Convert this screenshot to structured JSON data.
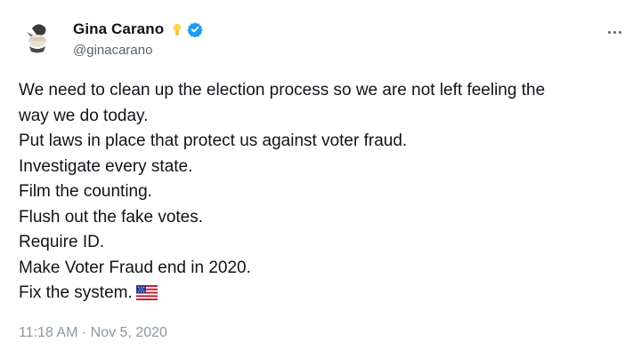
{
  "author": {
    "display_name": "Gina Carano",
    "handle": "@ginacarano",
    "avatar_icon": "avatar-image",
    "badges": [
      "lightbulb-icon",
      "verified-badge-icon"
    ],
    "verified_color": "#1d9bf0"
  },
  "tweet": {
    "lines": [
      "We need to clean up the election process so we are not left feeling the",
      "way we do today.",
      "Put laws in place that protect us against voter fraud.",
      "Investigate every state.",
      "Film the counting.",
      "Flush out the fake votes.",
      "Require ID.",
      "Make Voter Fraud end in 2020.",
      "Fix the system."
    ],
    "trailing_emoji": "us-flag-icon",
    "timestamp": "11:18 AM · Nov 5, 2020"
  },
  "menu": {
    "more_icon": "more-options-icon"
  }
}
